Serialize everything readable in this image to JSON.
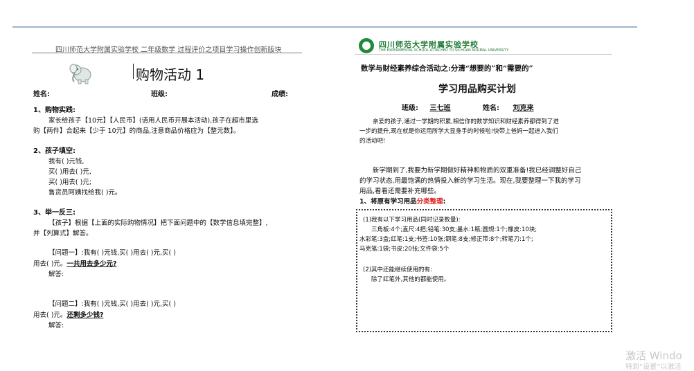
{
  "left": {
    "header": "四川师范大学附属实验学校  二年级数学  过程评价之项目学习操作创新版块",
    "title": "购物活动 1",
    "name_label": "姓名:",
    "class_label": "班级:",
    "score_label": "成绩:",
    "s1": {
      "heading": "1、购物实践:",
      "line1": "家长给孩子【10元】【人民币】(请用人民币开展本活动),孩子在超市里选",
      "line2": "购【两件】合起来【少于 10元】的商品,注意商品价格应为【整元数】。"
    },
    "s2": {
      "heading": "2、孩子填空:",
      "lines": [
        "我有(       )元钱,",
        "买(          )用去(       )元,",
        "买(          )用去(       )元;",
        "售货员阿姨找给我(          )元。"
      ]
    },
    "s3": {
      "heading": "3、举一反三:",
      "line1": "【孩子】根据【上面的实际购物情况】把下面问题中的【数学信息填完整】,",
      "line2": "并【列算式】解答。",
      "q1": {
        "main": "【问题一】:我有(       )元钱,买(            )用去(       )元,买(            )",
        "tail_a": "用去(       )元。",
        "tail_b": "一共用去多少元?",
        "answer": "解答:"
      },
      "q2": {
        "main": "【问题二】:我有(       )元钱,买(            )用去(       )元,买(            )",
        "tail_a": "用去(       )元。",
        "tail_b": "还剩多少钱?",
        "answer": "解答:"
      }
    }
  },
  "right": {
    "logo_text": "四川师范大学附属实验学校",
    "logo_sub": "THE EXPERIMENTAL SCHOOL ATTACHED TO SICHUAN NORMAL UNIVERSITY",
    "subject": "数学与财经素养综合活动之:分清“想要的”和“需要的”",
    "title": "学习用品购买计划",
    "class_label": "班级:",
    "class_value": "三七班",
    "name_label": "姓名:",
    "name_value": "刘克来",
    "intro1": "亲爱的孩子,通过一学期的积累,相信你的数学知识和财经素养都得到了进",
    "intro2": "一步的提升,现在就是你运用所学大显身手的时候啦!快带上爸妈一起进入我们",
    "intro3": "的活动吧!",
    "para1": "新学期到了,我要为新学期做好精神和物质的双重准备!我已经调整好自己",
    "para2": "的学习状态,用最饱满的热情投入新的学习生活。现在,我要整理一下我的学习",
    "para3": "用品,看看还需要补充哪些。",
    "s1_prefix": "1、将原有学习用品",
    "s1_red": "分类整理",
    "s1_suffix": ":",
    "box": {
      "item1_title": "(1)我有以下学习用品(同时记录数量):",
      "item1_l1": "三角板:4个;直尺:4把;铅笔:30支;墨水:1瓶;圆规:1个;橡皮:10块;",
      "item1_l2": "水彩笔:3盒;红笔:1支;书签:10张;钢笔:8支;修正带:8个;转笔刀:1个;",
      "item1_l3": "马克笔:1袋;书皮:20张;文件袋:5个",
      "item2_title": "(2)其中还能继续使用的有:",
      "item2_l1": "除了红笔外,其他的都能使用。"
    }
  },
  "watermark": {
    "line1": "激活 Windo",
    "line2": "转到“设置”以激活"
  }
}
